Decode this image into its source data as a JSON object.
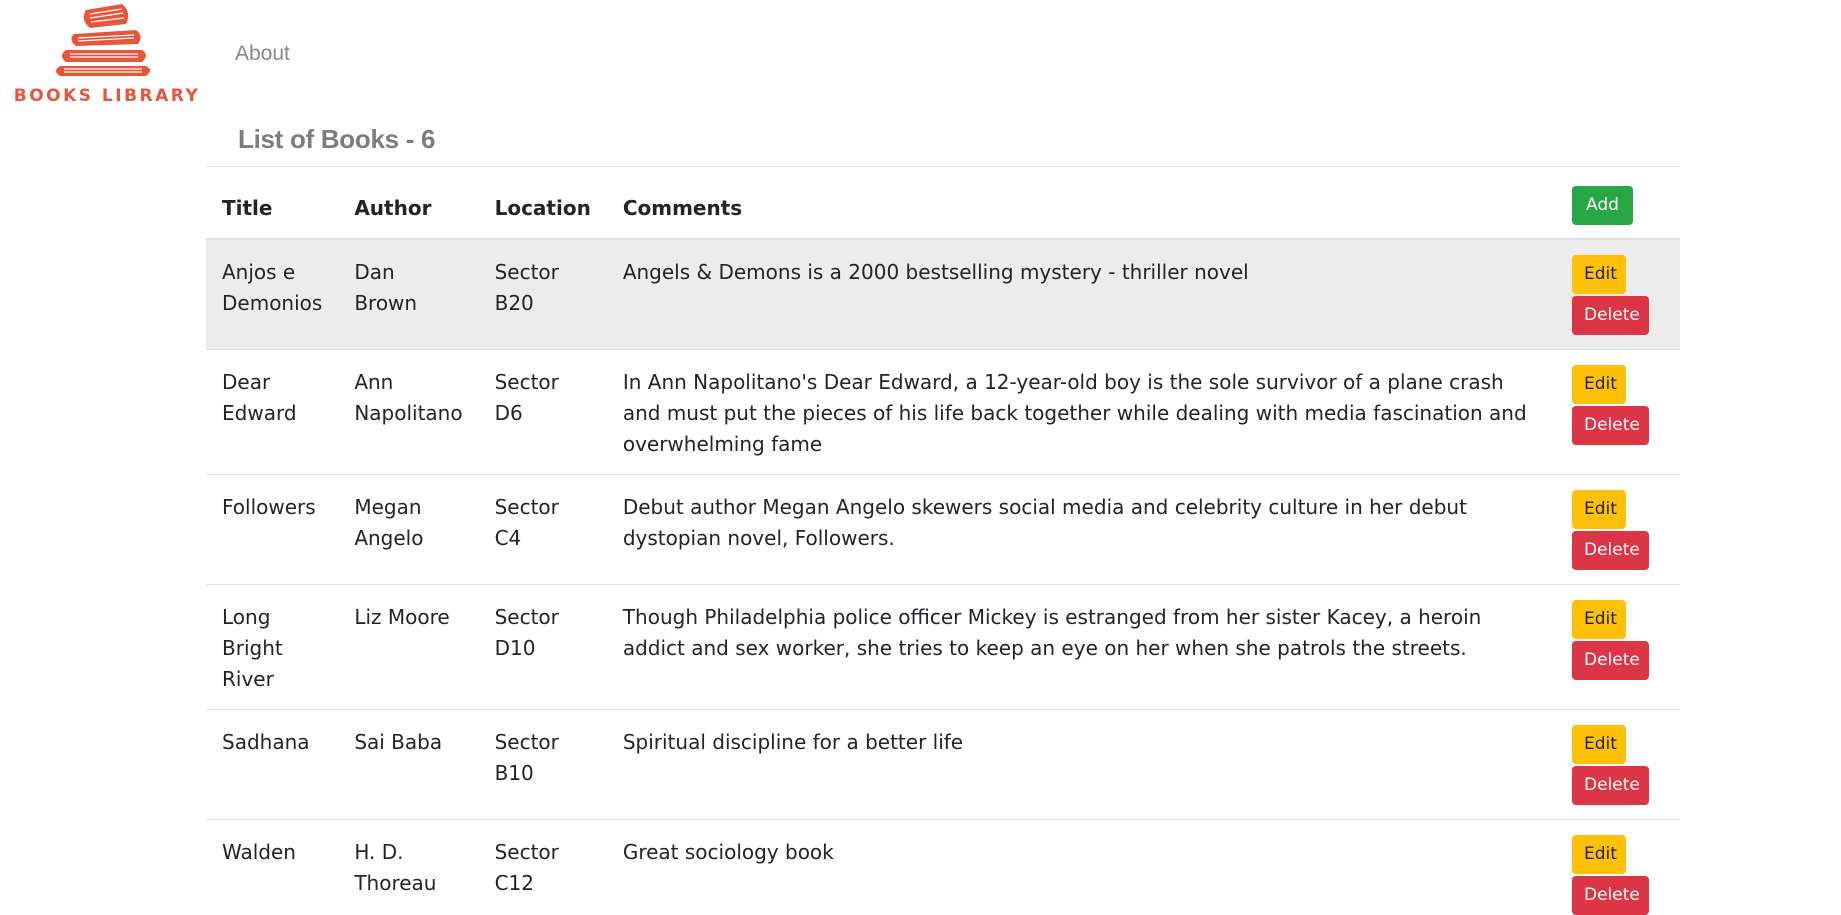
{
  "brand": {
    "name": "BOOKS LIBRARY",
    "logo_icon": "book-stack-icon",
    "accent": "#e8553a"
  },
  "nav": {
    "about": "About"
  },
  "page": {
    "title": "List of Books - 6"
  },
  "table": {
    "headers": {
      "title": "Title",
      "author": "Author",
      "location": "Location",
      "comments": "Comments"
    },
    "add_label": "Add",
    "edit_label": "Edit",
    "delete_label": "Delete",
    "rows": [
      {
        "title": "Anjos e Demonios",
        "author": "Dan Brown",
        "location": "Sector B20",
        "comments": "Angels & Demons is a 2000 bestselling mystery - thriller novel"
      },
      {
        "title": "Dear Edward",
        "author": "Ann Napolitano",
        "location": "Sector D6",
        "comments": "In Ann Napolitano's Dear Edward, a 12-year-old boy is the sole survivor of a plane crash and must put the pieces of his life back together while dealing with media fascination and overwhelming fame"
      },
      {
        "title": "Followers",
        "author": "Megan Angelo",
        "location": "Sector C4",
        "comments": "Debut author Megan Angelo skewers social media and celebrity culture in her debut dystopian novel, Followers."
      },
      {
        "title": "Long Bright River",
        "author": "Liz Moore",
        "location": "Sector D10",
        "comments": "Though Philadelphia police officer Mickey is estranged from her sister Kacey, a heroin addict and sex worker, she tries to keep an eye on her when she patrols the streets."
      },
      {
        "title": "Sadhana",
        "author": "Sai Baba",
        "location": "Sector B10",
        "comments": "Spiritual discipline for a better life"
      },
      {
        "title": "Walden",
        "author": "H. D. Thoreau",
        "location": "Sector C12",
        "comments": "Great sociology book"
      }
    ]
  },
  "colors": {
    "add": "#28a745",
    "edit": "#ffc107",
    "delete": "#dc3545",
    "highlight_row": "#ececec"
  }
}
